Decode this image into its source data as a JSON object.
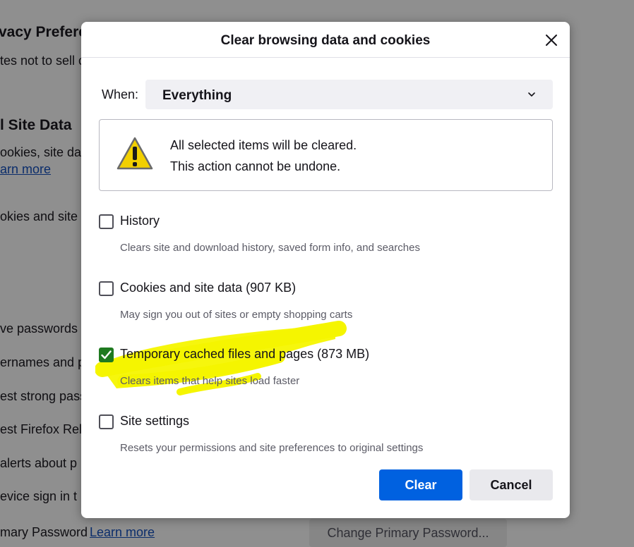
{
  "background": {
    "heading_privacy": "vacy Prefere",
    "line_sell": "tes not to sell c",
    "heading_site_data": "l Site Data",
    "line_cookies": "ookies, site dat",
    "link_learn_more_1": "arn more",
    "line_cookies_site": "okies and site c",
    "line_save_passwords": "ve passwords",
    "line_usernames": "ernames and p",
    "line_strong_pass": "est strong pass",
    "line_firefox_relay": "est Firefox Rela",
    "line_alerts": "alerts about p",
    "line_device_signin": "evice sign in t",
    "line_primary_password": "mary Password",
    "link_learn_more_2": "Learn more",
    "button_change_primary": "Change Primary Password..."
  },
  "dialog": {
    "title": "Clear browsing data and cookies",
    "when": {
      "label": "When:",
      "value": "Everything"
    },
    "warning": {
      "line1": "All selected items will be cleared.",
      "line2": "This action cannot be undone."
    },
    "items": [
      {
        "label": "History",
        "description": "Clears site and download history, saved form info, and searches",
        "checked": false
      },
      {
        "label": "Cookies and site data (907 KB)",
        "description": "May sign you out of sites or empty shopping carts",
        "checked": false
      },
      {
        "label": "Temporary cached files and pages (873 MB)",
        "description": "Clears items that help sites load faster",
        "checked": true
      },
      {
        "label": "Site settings",
        "description": "Resets your permissions and site preferences to original settings",
        "checked": false
      }
    ],
    "buttons": {
      "clear": "Clear",
      "cancel": "Cancel"
    }
  },
  "colors": {
    "accent": "#0061e0",
    "checkbox_checked": "#1f7a20",
    "highlighter": "#f5f500",
    "overlay": "#8f8f8f"
  },
  "icons": {
    "close": "close-icon",
    "chevron": "chevron-down-icon",
    "warning": "warning-icon",
    "check": "checkmark-icon"
  }
}
